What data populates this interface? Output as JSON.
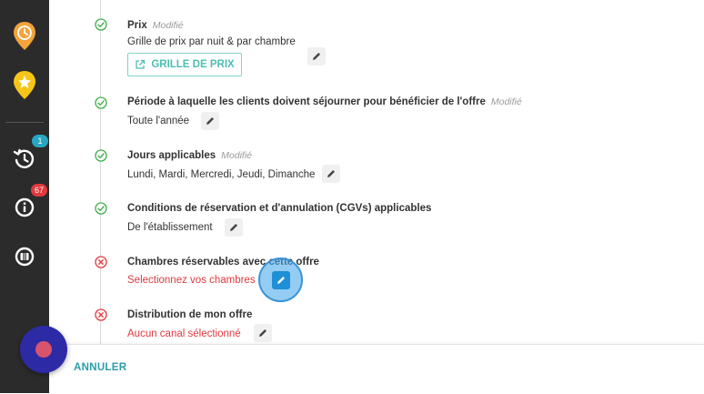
{
  "sidebar": {
    "icons": [
      {
        "name": "clock-pin-icon",
        "color": "#f2a33a"
      },
      {
        "name": "star-pin-icon",
        "color": "#f5c518"
      },
      {
        "name": "history-icon",
        "badge": "1",
        "badge_color": "#29a6c3"
      },
      {
        "name": "info-icon",
        "badge": "67",
        "badge_color": "#e0393e"
      },
      {
        "name": "luggage-icon"
      }
    ]
  },
  "steps": [
    {
      "title": "Prix",
      "modified": "Modifié",
      "value": "Grille de prix par nuit & par chambre",
      "status": "ok",
      "button": "GRILLE DE PRIX"
    },
    {
      "title": "Période à laquelle les clients doivent séjourner pour bénéficier de l'offre",
      "modified": "Modifié",
      "value": "Toute l'année",
      "status": "ok"
    },
    {
      "title": "Jours applicables",
      "modified": "Modifié",
      "value": "Lundi, Mardi, Mercredi, Jeudi, Dimanche",
      "status": "ok"
    },
    {
      "title": "Conditions de réservation et d'annulation (CGVs) applicables",
      "value": "De l'établissement",
      "status": "ok"
    },
    {
      "title": "Chambres réservables avec cette offre",
      "value": "Selectionnez vos chambres",
      "status": "error"
    },
    {
      "title": "Distribution de mon offre",
      "value": "Aucun canal sélectionné",
      "status": "error"
    }
  ],
  "footer": {
    "cancel_label": "ANNULER"
  },
  "colors": {
    "ok": "#3fae49",
    "error": "#e0393e",
    "accent": "#4cbfb2"
  }
}
